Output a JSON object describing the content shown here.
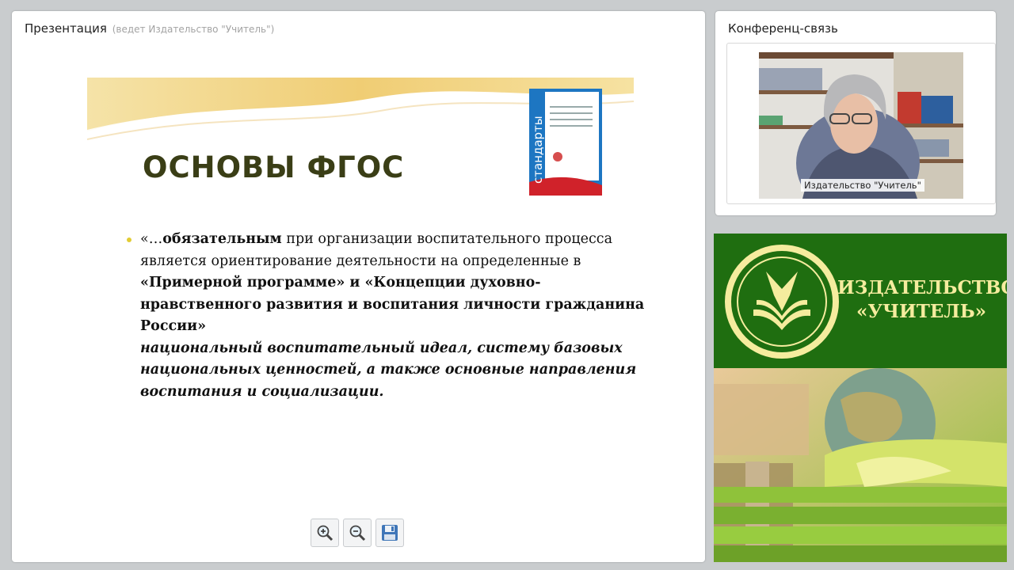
{
  "presentation": {
    "title": "Презентация",
    "subtitle": "(ведет Издательство \"Учитель\")",
    "slide": {
      "heading": "ОСНОВЫ ФГОС",
      "book_cover_text": "стандарты",
      "body": {
        "p1": "«…",
        "p2": "обязательным",
        "p3": " при организации воспитательного процесса является  ориентирование деятельности на определенные в ",
        "p4": "«Примерной программе» и «Концепции духовно-нравственного развития и воспитания личности гражданина России»",
        "p5": "национальный воспитательный идеал, систему базовых национальных ценностей, а также  основные направления воспитания и социализации."
      }
    },
    "toolbar": {
      "zoom_in": "zoom-in",
      "zoom_out": "zoom-out",
      "save": "save"
    }
  },
  "conference": {
    "title": "Конференц-связь",
    "video_label": "Издательство \"Учитель\""
  },
  "brand": {
    "line1": "ИЗДАТЕЛЬСТВО",
    "line2": "«УЧИТЕЛЬ»"
  },
  "colors": {
    "heading": "#3a3e16",
    "brand_green": "#1f6e10",
    "brand_text": "#f5ec9e",
    "bullet": "#e2cc34"
  }
}
